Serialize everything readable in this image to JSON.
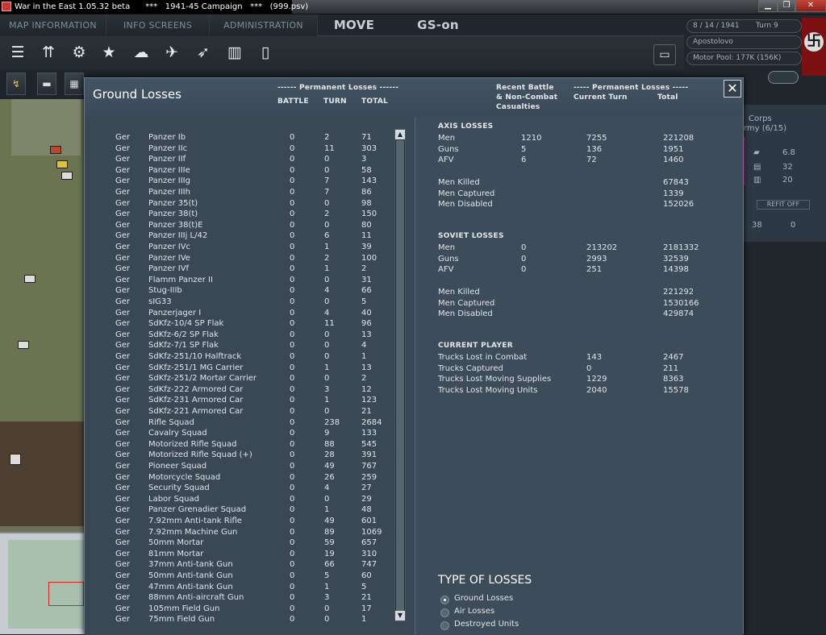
{
  "window": {
    "title": "War in the East 1.05.32 beta      ***   1941-45 Campaign   ***   (999.psv)",
    "minimize": "▁",
    "maximize": "❐",
    "close": "✕"
  },
  "menu": {
    "tabs": [
      "MAP INFORMATION",
      "INFO SCREENS",
      "ADMINISTRATION"
    ],
    "move": "MOVE",
    "gs": "GS-on"
  },
  "toolbar_icons": [
    "layers-icon",
    "unit-icon",
    "gear-icon",
    "star-icon",
    "weather-icon",
    "air-icon",
    "rocket-icon",
    "fuel-icon",
    "document-icon",
    "card-icon"
  ],
  "status": {
    "date": "8 / 14 / 1941",
    "turn": "Turn 9",
    "location": "Apostolovo",
    "motor_pool": "Motor Pool: 177K (156K)"
  },
  "unit_card": {
    "line1": "Corps",
    "line2": "rmy (6/15)",
    "v1": "6.8",
    "v2": "32",
    "v3": "20",
    "refit": "REFIT OFF",
    "b1": "38",
    "b2": "0"
  },
  "dialog": {
    "title": "Ground Losses",
    "left_header": {
      "perm": "------ Permanent Losses ------",
      "battle": "BATTLE",
      "turn": "TURN",
      "total": "TOTAL"
    },
    "right_header": {
      "recent1": "Recent Battle",
      "recent2": "& Non-Combat",
      "recent3": "Casualties",
      "perm": "----- Permanent Losses -----",
      "current": "Current Turn",
      "total": "Total"
    },
    "close": "✕"
  },
  "losses": [
    [
      "Ger",
      "Panzer Ib",
      "0",
      "2",
      "71"
    ],
    [
      "Ger",
      "Panzer IIc",
      "0",
      "11",
      "303"
    ],
    [
      "Ger",
      "Panzer IIf",
      "0",
      "0",
      "3"
    ],
    [
      "Ger",
      "Panzer IIIe",
      "0",
      "0",
      "58"
    ],
    [
      "Ger",
      "Panzer IIIg",
      "0",
      "7",
      "143"
    ],
    [
      "Ger",
      "Panzer IIIh",
      "0",
      "7",
      "86"
    ],
    [
      "Ger",
      "Panzer 35(t)",
      "0",
      "0",
      "98"
    ],
    [
      "Ger",
      "Panzer 38(t)",
      "0",
      "2",
      "150"
    ],
    [
      "Ger",
      "Panzer 38(t)E",
      "0",
      "0",
      "80"
    ],
    [
      "Ger",
      "Panzer IIIj L/42",
      "0",
      "6",
      "11"
    ],
    [
      "Ger",
      "Panzer IVc",
      "0",
      "1",
      "39"
    ],
    [
      "Ger",
      "Panzer IVe",
      "0",
      "2",
      "100"
    ],
    [
      "Ger",
      "Panzer IVf",
      "0",
      "1",
      "2"
    ],
    [
      "Ger",
      "Flamm Panzer II",
      "0",
      "0",
      "31"
    ],
    [
      "Ger",
      "Stug-IIIb",
      "0",
      "4",
      "66"
    ],
    [
      "Ger",
      "sIG33",
      "0",
      "0",
      "5"
    ],
    [
      "Ger",
      "Panzerjager I",
      "0",
      "4",
      "40"
    ],
    [
      "Ger",
      "SdKfz-10/4 SP Flak",
      "0",
      "11",
      "96"
    ],
    [
      "Ger",
      "SdKfz-6/2 SP Flak",
      "0",
      "0",
      "13"
    ],
    [
      "Ger",
      "SdKfz-7/1 SP Flak",
      "0",
      "0",
      "4"
    ],
    [
      "Ger",
      "SdKfz-251/10 Halftrack",
      "0",
      "0",
      "1"
    ],
    [
      "Ger",
      "SdKfz-251/1 MG Carrier",
      "0",
      "1",
      "13"
    ],
    [
      "Ger",
      "SdKfz-251/2 Mortar Carrier",
      "0",
      "0",
      "2"
    ],
    [
      "Ger",
      "SdKfz-222 Armored Car",
      "0",
      "3",
      "12"
    ],
    [
      "Ger",
      "SdKfz-231 Armored Car",
      "0",
      "1",
      "123"
    ],
    [
      "Ger",
      "SdKfz-221 Armored Car",
      "0",
      "0",
      "21"
    ],
    [
      "Ger",
      "Rifle Squad",
      "0",
      "238",
      "2684"
    ],
    [
      "Ger",
      "Cavalry Squad",
      "0",
      "9",
      "133"
    ],
    [
      "Ger",
      "Motorized Rifle Squad",
      "0",
      "88",
      "545"
    ],
    [
      "Ger",
      "Motorized Rifle Squad (+)",
      "0",
      "28",
      "391"
    ],
    [
      "Ger",
      "Pioneer Squad",
      "0",
      "49",
      "767"
    ],
    [
      "Ger",
      "Motorcycle Squad",
      "0",
      "26",
      "259"
    ],
    [
      "Ger",
      "Security Squad",
      "0",
      "4",
      "27"
    ],
    [
      "Ger",
      "Labor Squad",
      "0",
      "0",
      "29"
    ],
    [
      "Ger",
      "Panzer Grenadier Squad",
      "0",
      "1",
      "48"
    ],
    [
      "Ger",
      "7.92mm Anti-tank Rifle",
      "0",
      "49",
      "601"
    ],
    [
      "Ger",
      "7.92mm Machine Gun",
      "0",
      "89",
      "1069"
    ],
    [
      "Ger",
      "50mm Mortar",
      "0",
      "59",
      "657"
    ],
    [
      "Ger",
      "81mm Mortar",
      "0",
      "19",
      "310"
    ],
    [
      "Ger",
      "37mm Anti-tank Gun",
      "0",
      "66",
      "747"
    ],
    [
      "Ger",
      "50mm Anti-tank Gun",
      "0",
      "5",
      "60"
    ],
    [
      "Ger",
      "47mm Anti-tank Gun",
      "0",
      "1",
      "5"
    ],
    [
      "Ger",
      "88mm Anti-aircraft Gun",
      "0",
      "3",
      "21"
    ],
    [
      "Ger",
      "105mm Field Gun",
      "0",
      "0",
      "17"
    ],
    [
      "Ger",
      "75mm Field Gun",
      "0",
      "0",
      "1"
    ]
  ],
  "summary": {
    "axis": {
      "title": "AXIS LOSSES",
      "rows": [
        [
          "Men",
          "1210",
          "7255",
          "221208"
        ],
        [
          "Guns",
          "5",
          "136",
          "1951"
        ],
        [
          "AFV",
          "6",
          "72",
          "1460"
        ]
      ],
      "extra": [
        [
          "Men Killed",
          "67843"
        ],
        [
          "Men Captured",
          "1339"
        ],
        [
          "Men Disabled",
          "152026"
        ]
      ]
    },
    "soviet": {
      "title": "SOVIET LOSSES",
      "rows": [
        [
          "Men",
          "0",
          "213202",
          "2181332"
        ],
        [
          "Guns",
          "0",
          "2993",
          "32539"
        ],
        [
          "AFV",
          "0",
          "251",
          "14398"
        ]
      ],
      "extra": [
        [
          "Men Killed",
          "221292"
        ],
        [
          "Men Captured",
          "1530166"
        ],
        [
          "Men Disabled",
          "429874"
        ]
      ]
    },
    "player": {
      "title": "CURRENT PLAYER",
      "rows": [
        [
          "Trucks Lost in Combat",
          "143",
          "2467"
        ],
        [
          "Trucks Captured",
          "0",
          "211"
        ],
        [
          "Trucks Lost Moving Supplies",
          "1229",
          "8363"
        ],
        [
          "Trucks Lost Moving Units",
          "2040",
          "15578"
        ]
      ]
    }
  },
  "type_of_losses": {
    "title": "TYPE OF LOSSES",
    "options": [
      "Ground Losses",
      "Air Losses",
      "Destroyed Units"
    ],
    "selected": 0
  }
}
